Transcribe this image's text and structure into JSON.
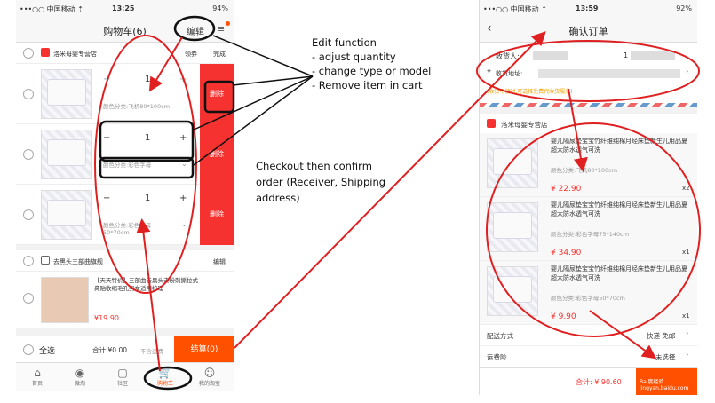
{
  "left_phone": {
    "status": {
      "carrier": "•••○○ 中国移动 ⇡",
      "time": "13:25",
      "battery": "94%"
    },
    "title": "购物车(6)",
    "edit_label": "编辑",
    "store1": {
      "name": "洛米母婴专营店",
      "coupon": "领券",
      "done": "完成"
    },
    "items": [
      {
        "qty": "1",
        "spec": "颜色分类:飞机80*100cm",
        "delete": "删除"
      },
      {
        "qty": "1",
        "spec": "颜色分类:彩色字母",
        "delete": "删除"
      },
      {
        "qty": "1",
        "spec": "颜色分类:彩色字母 50*70cm",
        "delete": "删除"
      }
    ],
    "store2": {
      "name": "去黑头三部曲旗舰",
      "edit": "编辑"
    },
    "promo": {
      "text": "【天天特价】三部曲去黑头去粉刺撕拉式鼻贴收缩毛孔男女适用护理",
      "price": "¥19.90"
    },
    "footer": {
      "select_all": "全选",
      "total": "合计:¥0.00",
      "shipping": "不含运费",
      "checkout": "结算(0)"
    },
    "tabs": [
      {
        "label": "首页",
        "icon": "home-icon"
      },
      {
        "label": "微淘",
        "icon": "broadcast-icon"
      },
      {
        "label": "社区",
        "icon": "chat-icon"
      },
      {
        "label": "购物车",
        "icon": "cart-icon"
      },
      {
        "label": "我的淘宝",
        "icon": "user-icon"
      }
    ]
  },
  "right_phone": {
    "status": {
      "carrier": "•••○○ 中国移动 ⇡",
      "time": "13:59",
      "battery": "92%"
    },
    "title": "确认订单",
    "receiver_label": "收货人:",
    "receiver_value": "1",
    "address_label": "收货地址:",
    "notice": "(收货不便时,可选择免费代收货服务)",
    "store": "洛米母婴专营店",
    "items": [
      {
        "desc": "婴儿隔尿垫宝宝竹纤维纯棉月经床垫新生儿用品夏超大防水透气可洗",
        "spec": "颜色分类:飞机80*100cm",
        "price": "¥ 22.90",
        "count": "x2"
      },
      {
        "desc": "婴儿隔尿垫宝宝竹纤维纯棉月经床垫新生儿用品夏超大防水透气可洗",
        "spec": "颜色分类:彩色字母75*140cm",
        "price": "¥ 34.90",
        "count": "x1"
      },
      {
        "desc": "婴儿隔尿垫宝宝竹纤维纯棉月经床垫新生儿用品夏超大防水透气可洗",
        "spec": "颜色分类:彩色字母50*70cm",
        "price": "¥ 9.90",
        "count": "x1"
      }
    ],
    "delivery_label": "配送方式",
    "delivery_value": "快递 免邮",
    "insurance_label": "运费险",
    "insurance_value": "未选择",
    "total": "合计: ¥ 90.60",
    "watermark": "Bai度经验 jingyan.baidu.com"
  },
  "annotations": {
    "edit_title": "Edit function",
    "edit_lines": [
      "- adjust quantity",
      "- change type or model",
      "- Remove item in cart"
    ],
    "checkout_text": [
      "Checkout then confirm",
      "order (Receiver, Shipping",
      "address)"
    ]
  },
  "colors": {
    "accent": "#f5322f",
    "checkout": "#ff5000"
  }
}
